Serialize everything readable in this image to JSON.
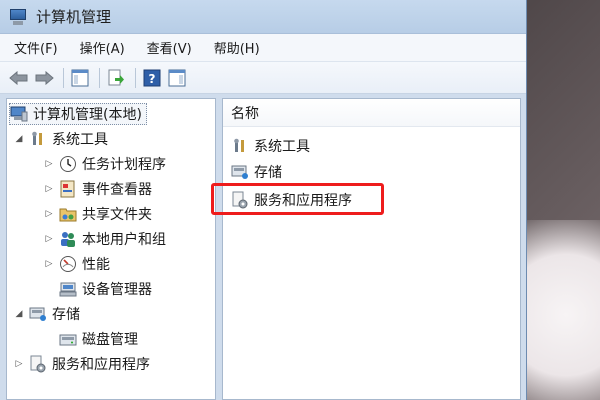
{
  "window": {
    "title": "计算机管理"
  },
  "menu": [
    {
      "label": "文件(F)"
    },
    {
      "label": "操作(A)"
    },
    {
      "label": "查看(V)"
    },
    {
      "label": "帮助(H)"
    }
  ],
  "tree": {
    "root": "计算机管理(本地)",
    "system_tools": "系统工具",
    "task_scheduler": "任务计划程序",
    "event_viewer": "事件查看器",
    "shared_folders": "共享文件夹",
    "local_users": "本地用户和组",
    "performance": "性能",
    "device_manager": "设备管理器",
    "storage": "存储",
    "disk_management": "磁盘管理",
    "services_apps": "服务和应用程序"
  },
  "list": {
    "column_name": "名称",
    "items": [
      "系统工具",
      "存储",
      "服务和应用程序"
    ]
  },
  "colors": {
    "highlight": "#ee1c1c",
    "titlebar": "#c6d9ee"
  }
}
